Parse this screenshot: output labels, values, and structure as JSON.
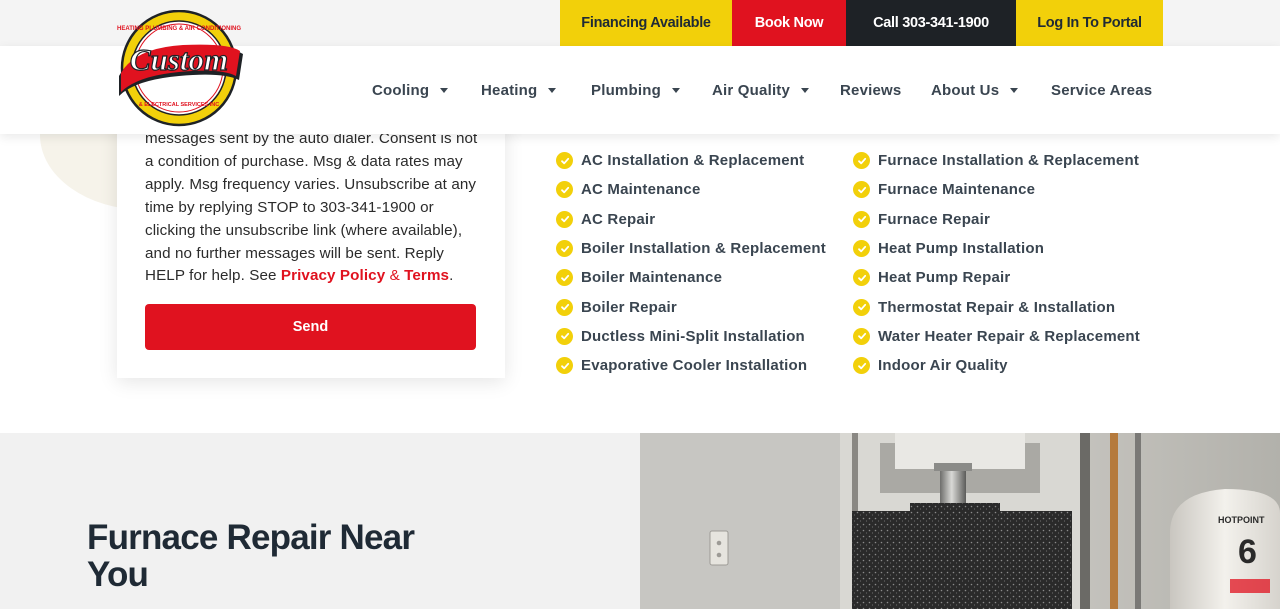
{
  "utility_bar": {
    "financing_label": "Financing Available",
    "book_label": "Book Now",
    "call_label": "Call 303-341-1900",
    "portal_label": "Log In To Portal"
  },
  "brand": {
    "logo_text": "Custom",
    "logo_ring_text": "HEATING PLUMBING & AIR CONDITIONING",
    "logo_bottom_text": "& ELECTRICAL SERVICES INC"
  },
  "nav": {
    "items": [
      {
        "label": "Cooling",
        "dropdown": true
      },
      {
        "label": "Heating",
        "dropdown": true
      },
      {
        "label": "Plumbing",
        "dropdown": true
      },
      {
        "label": "Air Quality",
        "dropdown": true
      },
      {
        "label": "Reviews",
        "dropdown": false
      },
      {
        "label": "About Us",
        "dropdown": true
      },
      {
        "label": "Service Areas",
        "dropdown": false
      }
    ]
  },
  "form": {
    "consent_text": "messages sent by the auto dialer. Consent is not a condition of purchase. Msg & data rates may apply. Msg frequency varies. Unsubscribe at any time by replying STOP to 303-341-1900 or clicking the unsubscribe link (where available), and no further messages will be sent. Reply HELP for help. See ",
    "privacy_label": "Privacy Policy",
    "amp": " & ",
    "terms_label": "Terms",
    "period": ".",
    "send_label": "Send"
  },
  "services": {
    "column_1": [
      "AC Installation & Replacement",
      "AC Maintenance",
      "AC Repair",
      "Boiler Installation & Replacement",
      "Boiler Maintenance",
      "Boiler Repair",
      "Ductless Mini-Split Installation",
      "Evaporative Cooler Installation"
    ],
    "column_2": [
      "Furnace Installation & Replacement",
      "Furnace Maintenance",
      "Furnace Repair",
      "Heat Pump Installation",
      "Heat Pump Repair",
      "Thermostat Repair & Installation",
      "Water Heater Repair & Replacement",
      "Indoor Air Quality"
    ]
  },
  "section": {
    "title": "Furnace Repair Near You"
  },
  "photo": {
    "water_heater_brand": "HOTPOINT",
    "water_heater_number": "6"
  },
  "colors": {
    "accent_yellow": "#f2d00a",
    "accent_red": "#e0121f",
    "dark": "#1e2226",
    "text": "#3a4550"
  }
}
